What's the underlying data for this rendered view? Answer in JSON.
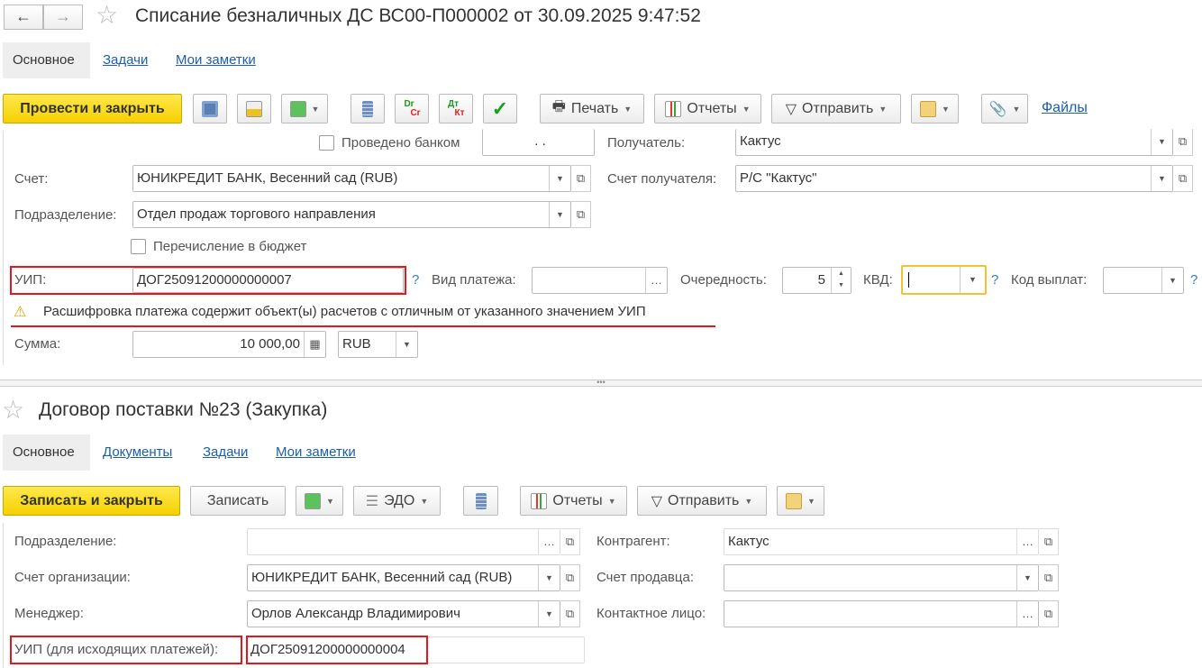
{
  "doc1": {
    "title": "Списание безналичных ДС ВС00-П000002 от 30.09.2025 9:47:52",
    "tabs": [
      "Основное",
      "Задачи",
      "Мои заметки"
    ],
    "toolbar": {
      "post_close": "Провести и закрыть",
      "print": "Печать",
      "reports": "Отчеты",
      "send": "Отправить",
      "files": "Файлы",
      "dr": "Dr",
      "cr": "Cr",
      "dt": "Дт",
      "kt": "Кт"
    },
    "form": {
      "bank_posted_label": "Проведено банком",
      "bank_posted_date": ". .",
      "recipient_label": "Получатель:",
      "recipient_value": "Кактус",
      "account_label": "Счет:",
      "account_value": "ЮНИКРЕДИТ БАНК, Весенний сад (RUB)",
      "recipient_account_label": "Счет получателя:",
      "recipient_account_value": "Р/С \"Кактус\"",
      "division_label": "Подразделение:",
      "division_value": "Отдел продаж торгового направления",
      "budget_label": "Перечисление в бюджет",
      "uip_label": "УИП:",
      "uip_value": "ДОГ25091200000000007",
      "payment_type_label": "Вид платежа:",
      "payment_type_value": "",
      "priority_label": "Очередность:",
      "priority_value": "5",
      "kvd_label": "КВД:",
      "kvd_value": "",
      "payout_code_label": "Код выплат:",
      "payout_code_value": "",
      "help": "?",
      "warning": "Расшифровка платежа содержит объект(ы) расчетов с отличным от указанного значением УИП",
      "sum_label": "Сумма:",
      "sum_value": "10 000,00",
      "currency": "RUB"
    }
  },
  "doc2": {
    "title": "Договор поставки №23 (Закупка)",
    "tabs": [
      "Основное",
      "Документы",
      "Задачи",
      "Мои заметки"
    ],
    "toolbar": {
      "save_close": "Записать и закрыть",
      "save": "Записать",
      "edo": "ЭДО",
      "reports": "Отчеты",
      "send": "Отправить"
    },
    "form": {
      "division_label": "Подразделение:",
      "division_value": "",
      "counterparty_label": "Контрагент:",
      "counterparty_value": "Кактус",
      "org_account_label": "Счет организации:",
      "org_account_value": "ЮНИКРЕДИТ БАНК, Весенний сад (RUB)",
      "seller_account_label": "Счет продавца:",
      "seller_account_value": "",
      "manager_label": "Менеджер:",
      "manager_value": "Орлов Александр Владимирович",
      "contact_label": "Контактное лицо:",
      "contact_value": "",
      "uip_label": "УИП (для исходящих платежей):",
      "uip_value": "ДОГ25091200000000004"
    }
  }
}
